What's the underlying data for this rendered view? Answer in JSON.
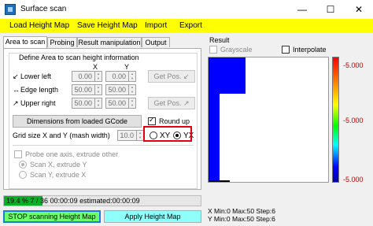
{
  "window": {
    "title": "Surface scan",
    "minimize": "—",
    "maximize": "☐",
    "close": "✕"
  },
  "menu": {
    "load": "Load Height Map",
    "save": "Save Height Map",
    "import": "Import",
    "export": "Export"
  },
  "tabs": [
    "Area to scan",
    "Probing",
    "Result manipulation",
    "Output"
  ],
  "area": {
    "group_title": "Define Area to scan height information",
    "col_x": "X",
    "col_y": "Y",
    "lower_left_label": "Lower left",
    "edge_length_label": "Edge length",
    "upper_right_label": "Upper right",
    "lower_left_x": "0.00",
    "lower_left_y": "0.00",
    "edge_x": "50.00",
    "edge_y": "50.00",
    "upper_right_x": "50.00",
    "upper_right_y": "50.00",
    "get_pos_1": "Get Pos.",
    "get_pos_2": "Get Pos.",
    "dimensions_button": "Dimensions from loaded GCode",
    "round_up_label": "Round up",
    "grid_size_label": "Grid size X and Y (mash width)",
    "grid_size_value": "10.0",
    "xy_label": "XY",
    "yx_label": "YX",
    "probe_one_axis_label": "Probe one axis, extrude other",
    "scan_x_label": "Scan X, extrude Y",
    "scan_y_label": "Scan Y, extrude X"
  },
  "progress": {
    "text": "19.4 % 7 / 36  00:00:09  estimated:00:00:09",
    "fraction": 0.194
  },
  "buttons": {
    "stop": "STOP scanning Height Map",
    "apply": "Apply Height Map"
  },
  "result": {
    "title": "Result",
    "grayscale_label": "Grayscale",
    "interpolate_label": "Interpolate",
    "scale_top": "-5.000",
    "scale_mid": "-5.000",
    "scale_bot": "-5.000",
    "x_info": "X Min:0 Max:50 Step:6",
    "y_info": "Y Min:0 Max:50 Step:6"
  },
  "colors": {
    "menu_bg": "#ffff00",
    "stop_bg": "#6cfe6c",
    "apply_bg": "#8ffffb",
    "highlight": "#e3000f",
    "plot_blue": "#0000ff",
    "progress": "#06b025"
  }
}
